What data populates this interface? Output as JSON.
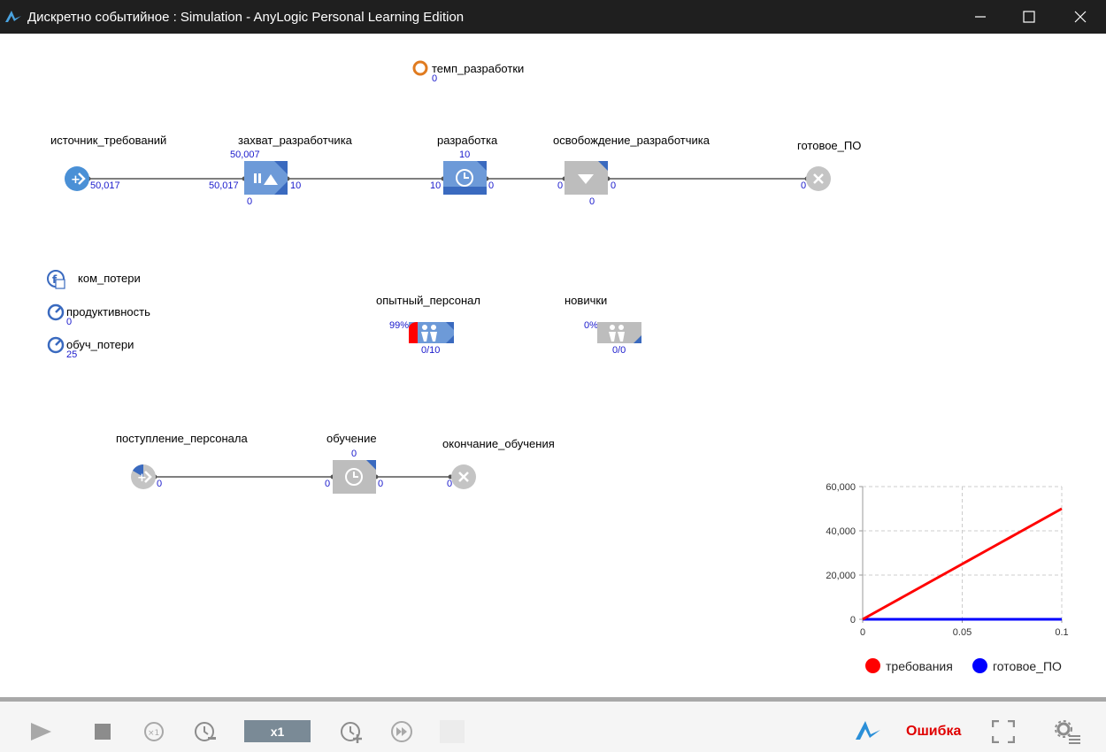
{
  "window": {
    "title": "Дискретно событийное : Simulation - AnyLogic Personal Learning Edition"
  },
  "model": {
    "temp_param": {
      "label": "темп_разработки",
      "value": "0"
    },
    "source": {
      "label": "источник_требований",
      "out_count": "50,017"
    },
    "seize": {
      "label": "захват_разработчика",
      "top": "50,007",
      "in_count": "50,017",
      "out_count": "10",
      "bottom": "0"
    },
    "delay": {
      "label": "разработка",
      "top": "10",
      "in_count": "10",
      "out_count": "0"
    },
    "release": {
      "label": "освобождение_разработчика",
      "in_count": "0",
      "out_count": "0",
      "bottom": "0"
    },
    "sink": {
      "label": "готовое_ПО",
      "in_count": "0"
    },
    "func": {
      "label": "ком_потери"
    },
    "dynvar1": {
      "label": "продуктивность",
      "value": "0"
    },
    "dynvar2": {
      "label": "обуч_потери",
      "value": "25"
    },
    "pool1": {
      "label": "опытный_персонал",
      "util": "99%",
      "count": "0/10"
    },
    "pool2": {
      "label": "новички",
      "util": "0%",
      "count": "0/0"
    },
    "source2": {
      "label": "поступление_персонала",
      "out_count": "0"
    },
    "delay2": {
      "label": "обучение",
      "top": "0",
      "in_count": "0",
      "out_count": "0"
    },
    "sink2": {
      "label": "окончание_обучения",
      "in_count": "0"
    }
  },
  "chart_data": {
    "type": "line",
    "title": "",
    "xlabel": "",
    "ylabel": "",
    "xlim": [
      0,
      0.1
    ],
    "ylim": [
      0,
      60000
    ],
    "x_ticks": [
      "0",
      "0.05",
      "0.1"
    ],
    "y_ticks": [
      "0",
      "20,000",
      "40,000",
      "60,000"
    ],
    "grid": true,
    "legend_position": "bottom",
    "series": [
      {
        "name": "требования",
        "color": "#ff0000",
        "x": [
          0,
          0.01,
          0.02,
          0.03,
          0.04,
          0.05,
          0.06,
          0.07,
          0.08,
          0.09,
          0.1
        ],
        "y": [
          0,
          5000,
          10000,
          15000,
          20000,
          25000,
          30000,
          35000,
          40000,
          45000,
          50000
        ]
      },
      {
        "name": "готовое_ПО",
        "color": "#0000ff",
        "x": [
          0,
          0.1
        ],
        "y": [
          0,
          0
        ]
      }
    ]
  },
  "toolbar": {
    "speed": "x1",
    "status": "Ошибка"
  }
}
